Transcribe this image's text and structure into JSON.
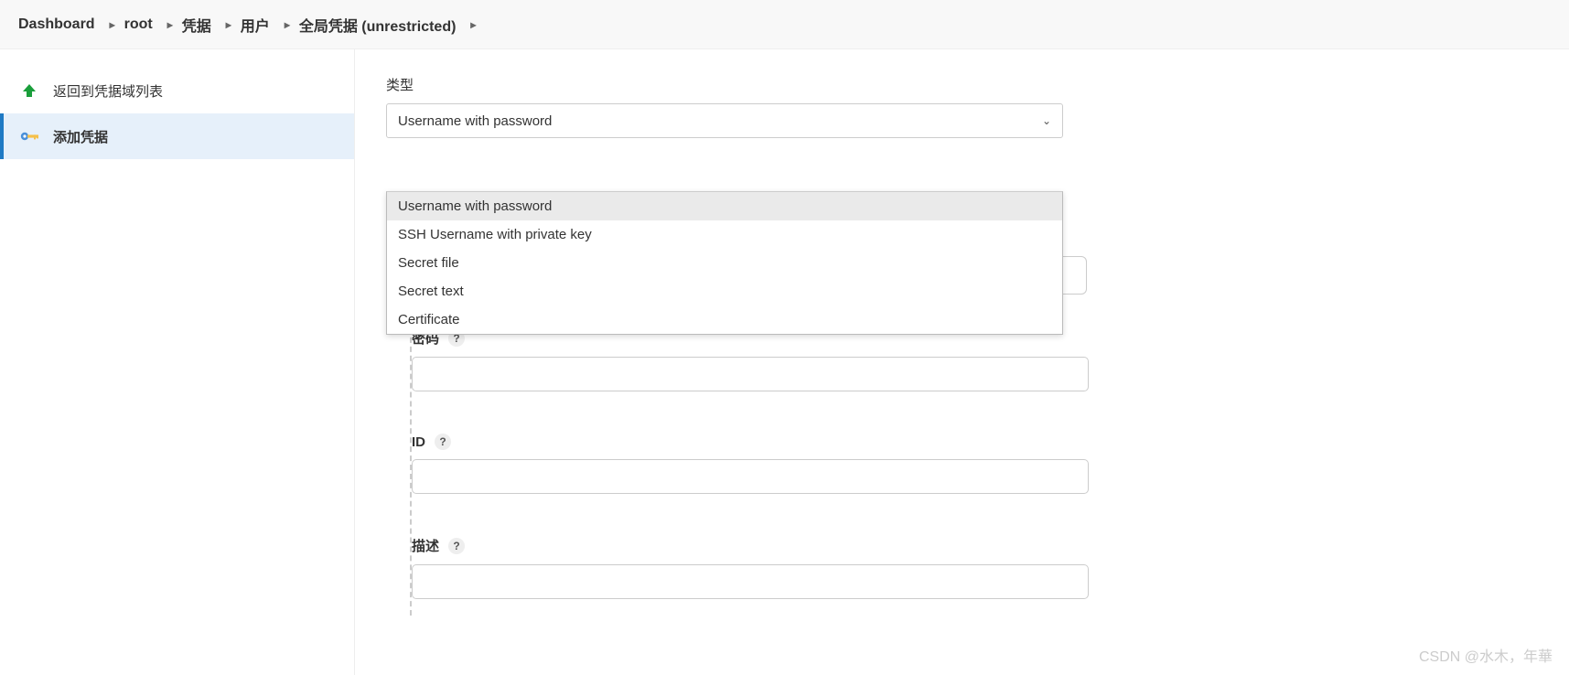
{
  "breadcrumb": {
    "items": [
      "Dashboard",
      "root",
      "凭据",
      "用户",
      "全局凭据 (unrestricted)"
    ]
  },
  "sidebar": {
    "back_label": "返回到凭据域列表",
    "add_label": "添加凭据"
  },
  "form": {
    "type_label": "类型",
    "type_selected": "Username with password",
    "type_options": [
      "Username with password",
      "SSH Username with private key",
      "Secret file",
      "Secret text",
      "Certificate"
    ],
    "password_label": "密码",
    "id_label": "ID",
    "desc_label": "描述",
    "password_value": "",
    "id_value": "",
    "desc_value": ""
  },
  "watermark": "CSDN @水木，年華"
}
